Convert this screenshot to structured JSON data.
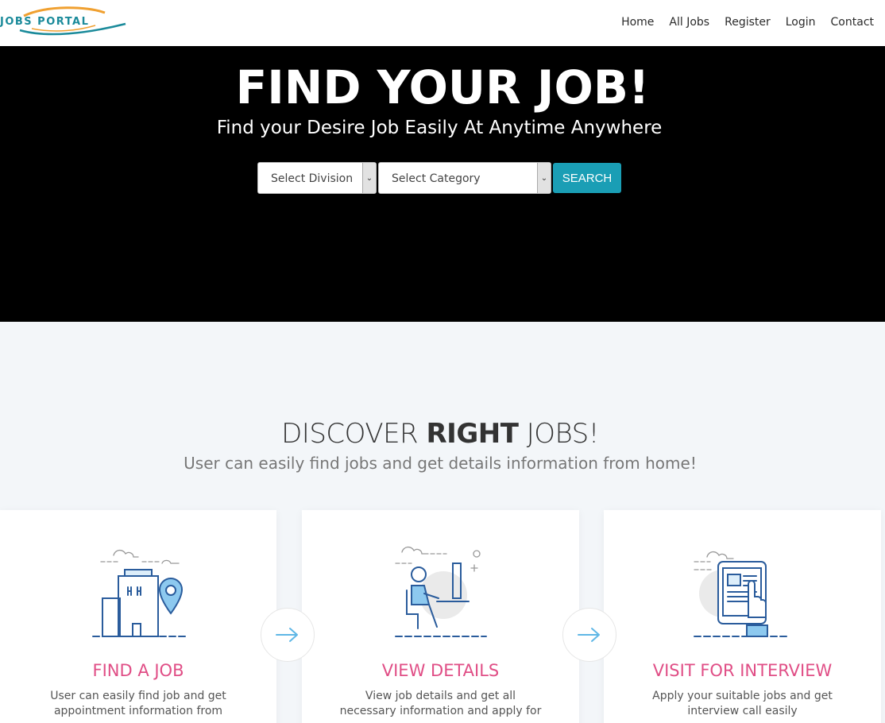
{
  "header": {
    "logo_text": "JOBS PORTAL",
    "nav": [
      "Home",
      "All Jobs",
      "Register",
      "Login",
      "Contact"
    ]
  },
  "hero": {
    "title": "FIND YOUR JOB!",
    "subtitle": "Find your Desire Job Easily At Anytime Anywhere",
    "division_select": "Select Division",
    "category_select": "Select Category",
    "search_label": "SEARCH"
  },
  "discover": {
    "title_pre": "DISCOVER ",
    "title_bold": "RIGHT",
    "title_post": " JOBS!",
    "subtitle": "User can easily find jobs and get details information from home!"
  },
  "cards": [
    {
      "title": "FIND A JOB",
      "desc": "User can easily find job and get appointment information from"
    },
    {
      "title": "VIEW DETAILS",
      "desc": "View job details and get all necessary information and apply for"
    },
    {
      "title": "VISIT FOR INTERVIEW",
      "desc": "Apply your suitable jobs and get interview call easily"
    }
  ],
  "colors": {
    "accent": "#1a9eb5",
    "card_title": "#e04e86",
    "hero_bg": "#000000",
    "icon_blue": "#2a5c9c",
    "icon_light": "#5fb7e6"
  }
}
